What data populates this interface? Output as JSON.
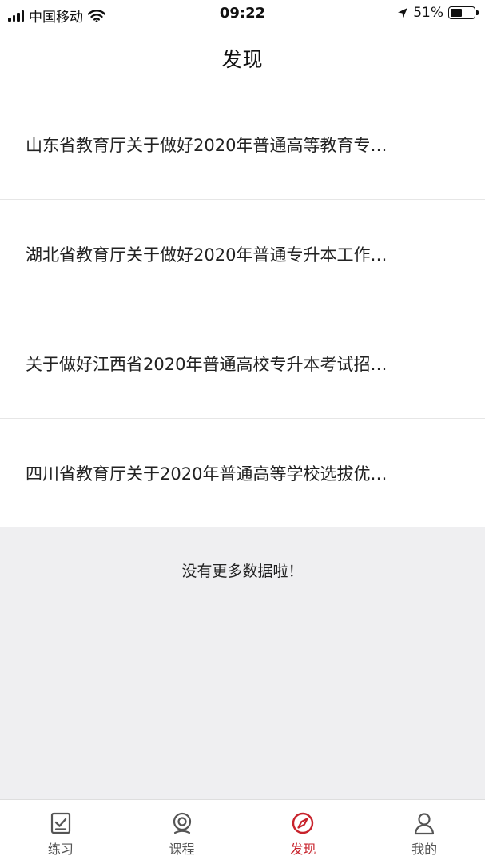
{
  "status_bar": {
    "carrier": "中国移动",
    "time": "09:22",
    "battery_text": "51%",
    "battery_level": 0.51
  },
  "nav": {
    "title": "发现"
  },
  "articles": [
    {
      "title": "山东省教育厅关于做好2020年普通高等教育专…"
    },
    {
      "title": "湖北省教育厅关于做好2020年普通专升本工作…"
    },
    {
      "title": "关于做好江西省2020年普通高校专升本考试招…"
    },
    {
      "title": "四川省教育厅关于2020年普通高等学校选拔优…"
    }
  ],
  "footer_message": "没有更多数据啦！",
  "tabs": [
    {
      "label": "练习",
      "icon": "checkbox-icon",
      "active": false
    },
    {
      "label": "课程",
      "icon": "webcam-icon",
      "active": false
    },
    {
      "label": "发现",
      "icon": "compass-icon",
      "active": true
    },
    {
      "label": "我的",
      "icon": "person-icon",
      "active": false
    }
  ],
  "colors": {
    "accent": "#c8232c",
    "inactive_icon": "#555555",
    "background": "#efeff1"
  }
}
